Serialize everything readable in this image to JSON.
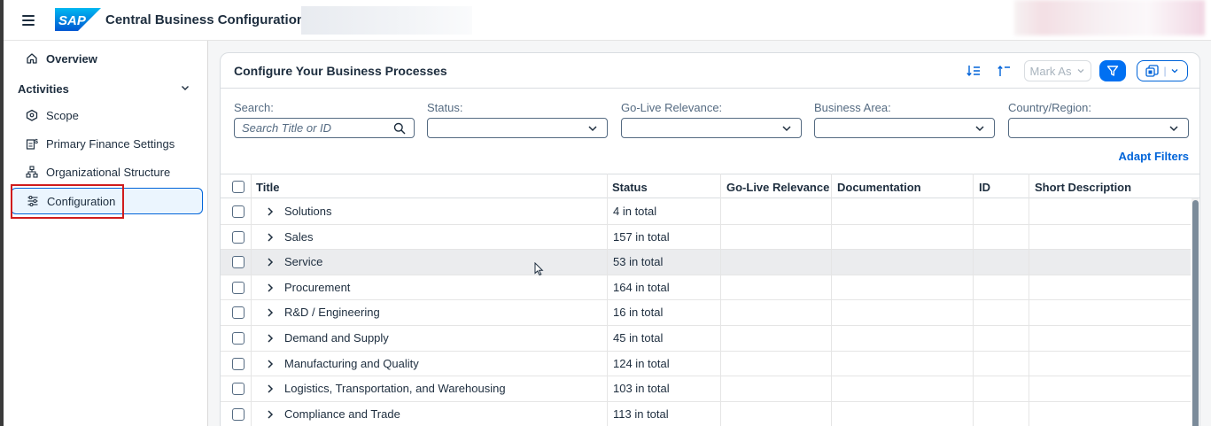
{
  "shell": {
    "title": "Central Business Configuration |",
    "logo_text": "SAP"
  },
  "sidenav": {
    "overview": "Overview",
    "group_label": "Activities",
    "items": [
      {
        "label": "Scope",
        "icon": "scope-icon"
      },
      {
        "label": "Primary Finance Settings",
        "icon": "finance-settings-icon"
      },
      {
        "label": "Organizational Structure",
        "icon": "org-structure-icon"
      },
      {
        "label": "Configuration",
        "icon": "configuration-icon"
      }
    ]
  },
  "card": {
    "title": "Configure Your Business Processes",
    "mark_as": "Mark As",
    "accent_color": "#0070f2"
  },
  "filters": {
    "search_label": "Search:",
    "search_placeholder": "Search Title or ID",
    "status_label": "Status:",
    "golive_label": "Go-Live Relevance:",
    "business_area_label": "Business Area:",
    "country_label": "Country/Region:",
    "adapt": "Adapt Filters"
  },
  "table": {
    "columns": [
      "Title",
      "Status",
      "Go-Live Relevance",
      "Documentation",
      "ID",
      "Short Description"
    ],
    "rows": [
      {
        "title": "Solutions",
        "status": "4 in total"
      },
      {
        "title": "Sales",
        "status": "157 in total"
      },
      {
        "title": "Service",
        "status": "53 in total"
      },
      {
        "title": "Procurement",
        "status": "164 in total"
      },
      {
        "title": "R&D / Engineering",
        "status": "16 in total"
      },
      {
        "title": "Demand and Supply",
        "status": "45 in total"
      },
      {
        "title": "Manufacturing and Quality",
        "status": "124 in total"
      },
      {
        "title": "Logistics, Transportation, and Warehousing",
        "status": "103 in total"
      },
      {
        "title": "Compliance and Trade",
        "status": "113 in total"
      }
    ]
  }
}
